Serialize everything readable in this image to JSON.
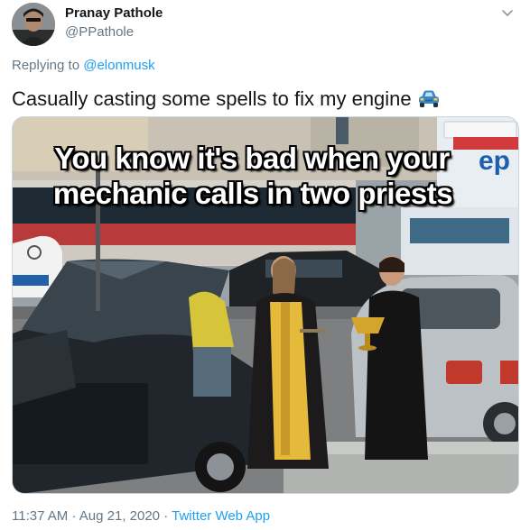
{
  "author": {
    "display_name": "Pranay Pathole",
    "handle": "@PPathole",
    "avatar_icon": "profile-avatar"
  },
  "reply": {
    "prefix": "Replying to",
    "mention": "@elonmusk"
  },
  "tweet": {
    "text": "Casually casting some spells to fix my engine",
    "emoji_icon": "blue-car-emoji"
  },
  "media": {
    "caption_line1": "You know it's bad when your",
    "caption_line2": "mechanic calls in two priests",
    "background_sign": "ep"
  },
  "meta": {
    "time": "11:37 AM",
    "separator1": "·",
    "date": "Aug 21, 2020",
    "separator2": "·",
    "source": "Twitter Web App"
  },
  "colors": {
    "text_primary": "#14171a",
    "text_secondary": "#657786",
    "link": "#1da1f2",
    "border": "#ccd6dd"
  }
}
